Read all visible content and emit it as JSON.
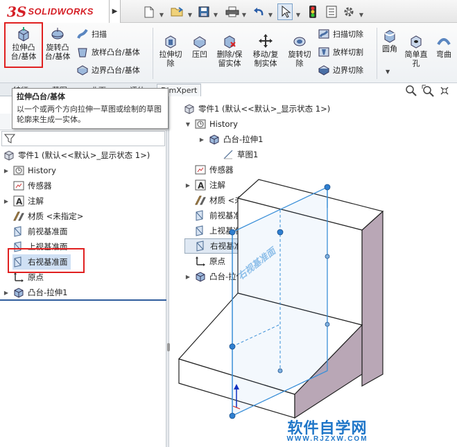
{
  "app": {
    "logo_ds": "3S",
    "logo_text": "SOLIDWORKS"
  },
  "ribbon": {
    "extrude_boss": "拉伸凸\n台/基体",
    "revolve_boss": "旋转凸\n台/基体",
    "sweep": "扫描",
    "loft_boss": "放样凸台/基体",
    "boundary_boss": "边界凸台/基体",
    "extrude_cut": "拉伸切\n除",
    "indent": "压凹",
    "delete_keep": "删除/保\n留实体",
    "move_copy": "移动/复\n制实体",
    "revolve_cut": "旋转切\n除",
    "sweep_cut": "扫描切除",
    "loft_cut": "放样切割",
    "boundary_cut": "边界切除",
    "fillet": "圆角",
    "simple_hole": "简单直\n孔",
    "flex": "弯曲"
  },
  "tabs": [
    "特征",
    "草图",
    "曲面",
    "评估",
    "DimXpert"
  ],
  "tooltip": {
    "title": "拉伸凸台/基体",
    "body": "以一个或两个方向拉伸一草图或绘制的草图轮廓来生成一实体。"
  },
  "left_tree": {
    "root": "零件1 (默认<<默认>_显示状态 1>)",
    "items": [
      {
        "label": "History",
        "icon": "history-icon",
        "expand": true
      },
      {
        "label": "传感器",
        "icon": "sensor-icon",
        "expand": false
      },
      {
        "label": "注解",
        "icon": "annotation-icon",
        "expand": true
      },
      {
        "label": "材质 <未指定>",
        "icon": "material-icon",
        "expand": false
      },
      {
        "label": "前视基准面",
        "icon": "plane-icon",
        "expand": false
      },
      {
        "label": "上视基准面",
        "icon": "plane-icon",
        "expand": false
      },
      {
        "label": "右视基准面",
        "icon": "plane-icon",
        "expand": false,
        "selected": true
      },
      {
        "label": "原点",
        "icon": "origin-icon",
        "expand": false
      },
      {
        "label": "凸台-拉伸1",
        "icon": "extrude-icon",
        "expand": true
      }
    ]
  },
  "viewport_tree": {
    "root": "零件1 (默认<<默认>_显示状态 1>)",
    "items": [
      {
        "label": "History",
        "icon": "history-icon",
        "expand": "down"
      },
      {
        "label": "凸台-拉伸1",
        "icon": "extrude-icon",
        "expand": "right"
      },
      {
        "label": "草图1",
        "icon": "sketch-icon",
        "expand": ""
      },
      {
        "label": "传感器",
        "icon": "sensor-icon",
        "expand": ""
      },
      {
        "label": "注解",
        "icon": "annotation-icon",
        "expand": "right"
      },
      {
        "label": "材质 <未指定>",
        "icon": "material-icon",
        "expand": ""
      },
      {
        "label": "前视基准面",
        "icon": "plane-icon",
        "expand": ""
      },
      {
        "label": "上视基准面",
        "icon": "plane-icon",
        "expand": ""
      },
      {
        "label": "右视基准面",
        "icon": "plane-icon",
        "expand": "",
        "highlighted": true
      },
      {
        "label": "原点",
        "icon": "origin-icon",
        "expand": ""
      },
      {
        "label": "凸台-拉伸1",
        "icon": "extrude-icon",
        "expand": "right"
      }
    ]
  },
  "model": {
    "plane_label": "右视基准面"
  },
  "watermark": {
    "title": "软件自学网",
    "url": "WWW.RJZXW.COM"
  },
  "colors": {
    "brand_red": "#d51f26",
    "highlight_red": "#e02020",
    "plane_blue": "#3a8fd8",
    "watermark_blue": "#1f76c8",
    "side_face": "#b9a7b6"
  }
}
